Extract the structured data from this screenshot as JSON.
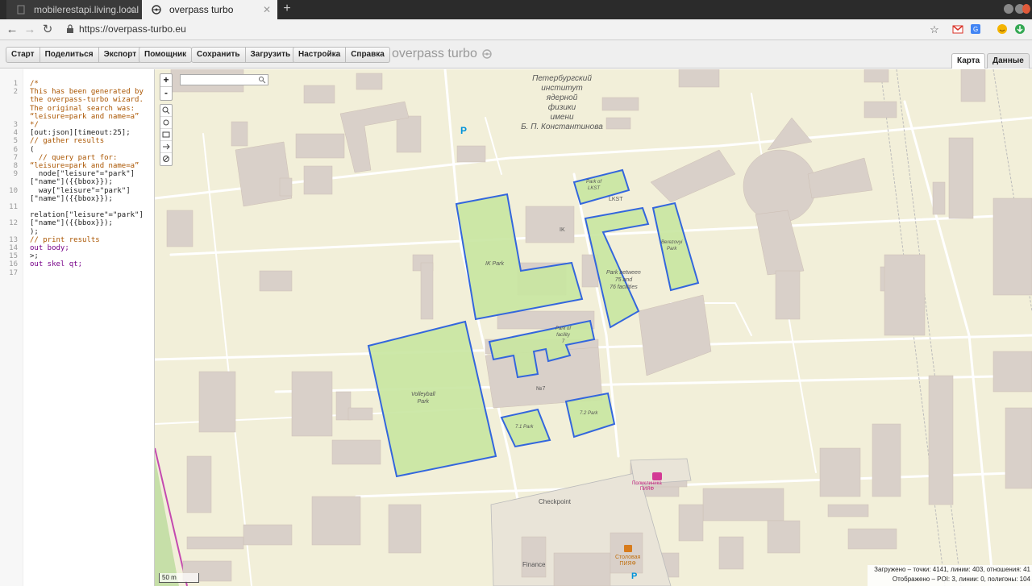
{
  "browser": {
    "tabs": [
      {
        "title": "mobilerestapi.living.local",
        "active": false,
        "close": "✕"
      },
      {
        "title": "overpass turbo",
        "active": true,
        "close": "✕"
      }
    ],
    "new_tab": "+",
    "url": "https://overpass-turbo.eu",
    "colors": {
      "gmail": "#d93025",
      "translate": "#4285f4",
      "smile": "#f4b400",
      "ext": "#34a853"
    }
  },
  "toolbar": {
    "groups": [
      [
        "Старт",
        "Поделиться",
        "Экспорт"
      ],
      [
        "Помощник"
      ],
      [
        "Сохранить",
        "Загрузить"
      ],
      [
        "Настройка",
        "Справка"
      ]
    ],
    "brand": "overpass turbo",
    "view_tabs": {
      "map": "Карта",
      "data": "Данные"
    }
  },
  "editor": {
    "line_numbers": [
      "1",
      "2",
      "",
      "",
      "",
      "3",
      "4",
      "5",
      "6",
      "7",
      "8",
      "9",
      "",
      "10",
      "",
      "11",
      "",
      "12",
      "",
      "13",
      "14",
      "15",
      "16",
      "17"
    ],
    "lines": [
      {
        "cls": "c-com",
        "text": "/*"
      },
      {
        "cls": "c-com",
        "text": "This has been generated by"
      },
      {
        "cls": "c-com",
        "text": "the overpass-turbo wizard."
      },
      {
        "cls": "c-com",
        "text": "The original search was:"
      },
      {
        "cls": "c-com",
        "text": "“leisure=park and name=a”"
      },
      {
        "cls": "c-com",
        "text": "*/"
      },
      {
        "cls": "",
        "text": "[out:json][timeout:25];"
      },
      {
        "cls": "c-com",
        "text": "// gather results"
      },
      {
        "cls": "",
        "text": "("
      },
      {
        "cls": "c-com",
        "text": "  // query part for:"
      },
      {
        "cls": "c-com",
        "text": "“leisure=park and name=a”"
      },
      {
        "cls": "",
        "text": "  node[\"leisure\"=\"park\"]"
      },
      {
        "cls": "",
        "text": "[\"name\"]({{bbox}});"
      },
      {
        "cls": "",
        "text": "  way[\"leisure\"=\"park\"]"
      },
      {
        "cls": "",
        "text": "[\"name\"]({{bbox}});"
      },
      {
        "cls": "",
        "text": ""
      },
      {
        "cls": "",
        "text": "relation[\"leisure\"=\"park\"]"
      },
      {
        "cls": "",
        "text": "[\"name\"]({{bbox}});"
      },
      {
        "cls": "",
        "text": ");"
      },
      {
        "cls": "c-com",
        "text": "// print results"
      },
      {
        "cls": "c-kw",
        "text": "out body;"
      },
      {
        "cls": "",
        "text": ">;"
      },
      {
        "cls": "c-kw",
        "text": "out skel qt;"
      }
    ]
  },
  "map": {
    "zoom_in": "+",
    "zoom_out": "-",
    "scale": "50 m",
    "stats": {
      "loaded": "Загружено – точки: 4141, линии: 403, отношения: 41",
      "shown": "Отображено – POI: 3, линии: 0, полигоны: 104"
    },
    "labels": {
      "institute": [
        "Петербургский",
        "институт",
        "ядерной",
        "физики",
        "имени",
        "Б. П. Константинова"
      ],
      "lkst": "LKST",
      "ik": "IK",
      "n7": "№7",
      "checkpoint": "Checkpoint",
      "finance": "Finance",
      "clinic": [
        "Поликлиника",
        "ПИЯФ"
      ],
      "canteen": [
        "Столовая",
        "ПИЯФ"
      ],
      "parking": "P"
    },
    "parks": {
      "ik": "IK Park",
      "lkst": [
        "Park of",
        "LKST"
      ],
      "between": [
        "Park between",
        "75 and",
        "76 facilities"
      ],
      "berezovyi": [
        "Berezovyi",
        "Park"
      ],
      "facility7": [
        "Park of",
        "facility",
        "7"
      ],
      "volleyball": [
        "Volleyball",
        "Park"
      ],
      "p71": "7.1 Park",
      "p72": "7.2 Park"
    },
    "colors": {
      "background": "#f2efd9",
      "building": "#d9d0c9",
      "park": "#c8e6a0",
      "outline": "#3366dd",
      "road": "#ffffff"
    }
  }
}
